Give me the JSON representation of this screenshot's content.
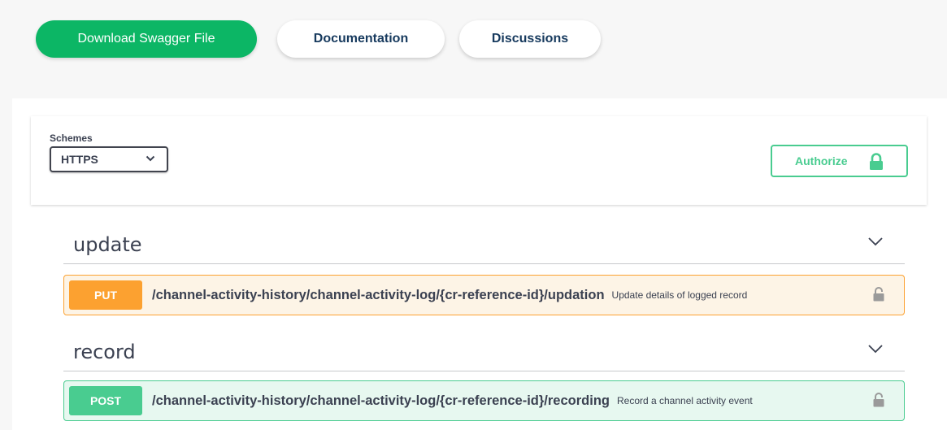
{
  "tabs": {
    "download": "Download Swagger File",
    "documentation": "Documentation",
    "discussions": "Discussions"
  },
  "schemes": {
    "label": "Schemes",
    "selected": "HTTPS"
  },
  "authorize": {
    "label": "Authorize"
  },
  "sections": [
    {
      "tag": "update",
      "operation": {
        "method": "PUT",
        "path": "/channel-activity-history/channel-activity-log/{cr-reference-id}/updation",
        "summary": "Update details of logged record"
      }
    },
    {
      "tag": "record",
      "operation": {
        "method": "POST",
        "path": "/channel-activity-history/channel-activity-log/{cr-reference-id}/recording",
        "summary": "Record a channel activity event"
      }
    }
  ],
  "colors": {
    "primary_green": "#0cb665",
    "accent_green": "#49cc90",
    "put_orange": "#fca130",
    "text_dark": "#3b4151",
    "tab_text_navy": "#173a5e"
  },
  "icons": {
    "select_chevron": "chevron-down-icon",
    "authorize_lock": "lock-icon",
    "tag_chevron": "chevron-down-icon",
    "operation_lock": "unlocked-icon"
  }
}
